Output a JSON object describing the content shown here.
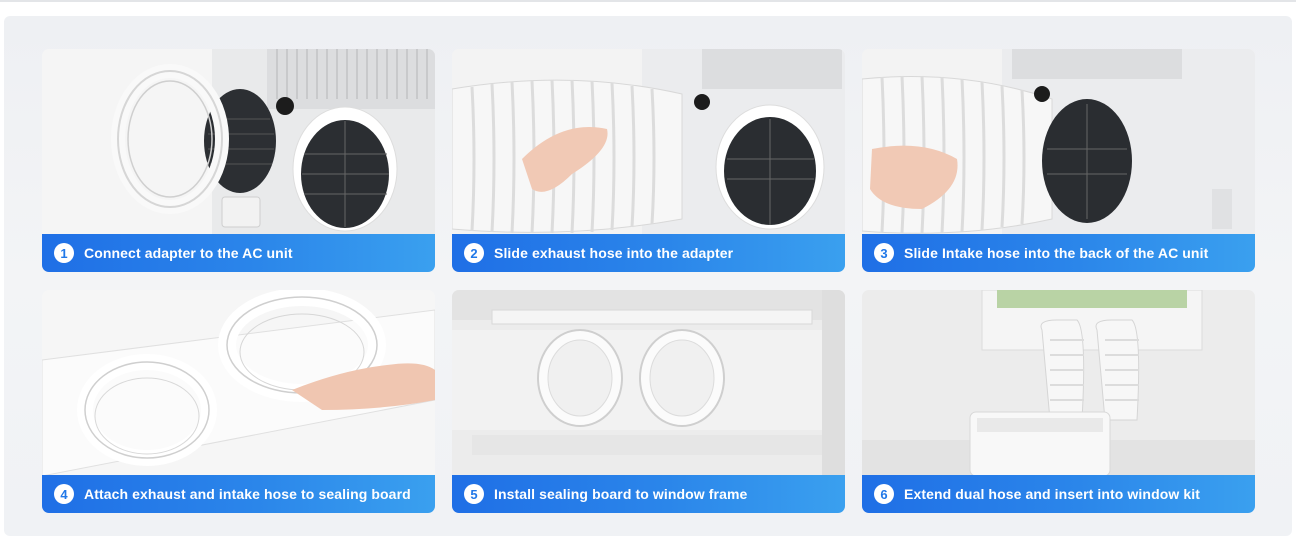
{
  "steps": [
    {
      "number": "1",
      "label": "Connect adapter to the AC unit"
    },
    {
      "number": "2",
      "label": "Slide exhaust hose into the adapter"
    },
    {
      "number": "3",
      "label": "Slide Intake hose into the back of the AC unit"
    },
    {
      "number": "4",
      "label": "Attach exhaust and intake hose to sealing board"
    },
    {
      "number": "5",
      "label": "Install sealing board to window frame"
    },
    {
      "number": "6",
      "label": "Extend dual hose and insert into window kit"
    }
  ],
  "colors": {
    "caption_start": "#1f6fe6",
    "caption_end": "#3aa0ef",
    "number_text": "#2178e8",
    "panel_background": "#eef0f3"
  }
}
